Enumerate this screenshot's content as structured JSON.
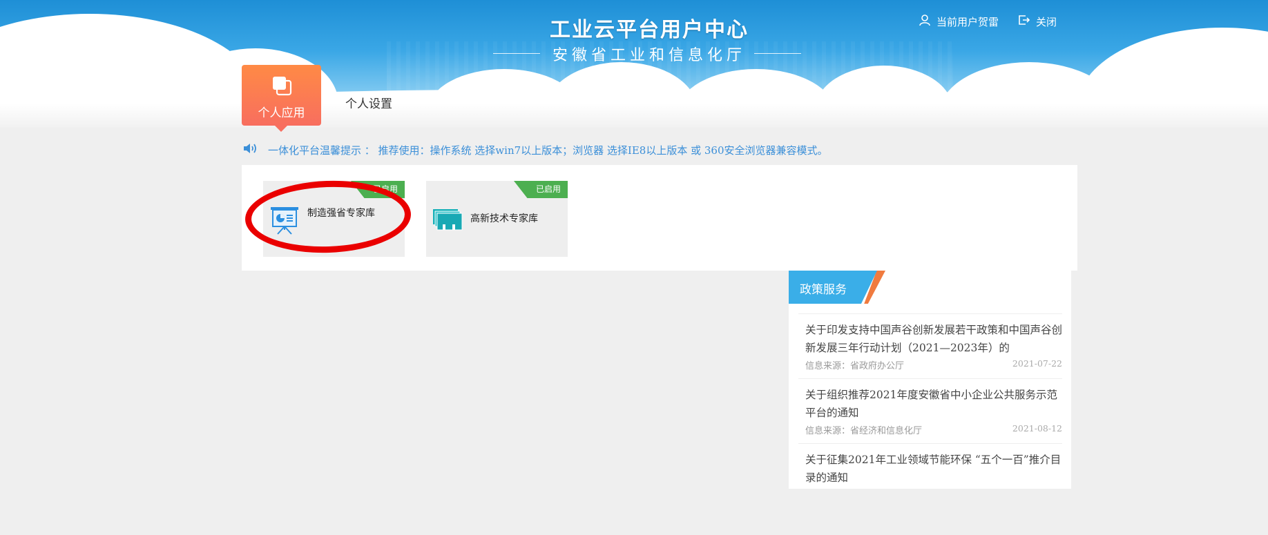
{
  "header": {
    "title": "工业云平台用户中心",
    "subtitle": "安徽省工业和信息化厅",
    "user_label": "当前用户贺雷",
    "close_label": "关闭"
  },
  "tabs": [
    {
      "label": "个人应用",
      "active": true
    },
    {
      "label": "个人设置",
      "active": false
    }
  ],
  "notice": {
    "text": "一体化平台温馨提示 ： 推荐使用：操作系统 选择win7以上版本；浏览器 选择IE8以上版本 或 360安全浏览器兼容模式。"
  },
  "apps": [
    {
      "name": "制造强省专家库",
      "status": "已启用",
      "icon": "presentation-board-icon",
      "highlighted": true
    },
    {
      "name": "高新技术专家库",
      "status": "已启用",
      "icon": "stacked-cards-icon",
      "highlighted": false
    }
  ],
  "policy": {
    "header": "政策服务",
    "items": [
      {
        "title": "关于印发支持中国声谷创新发展若干政策和中国声谷创新发展三年行动计划（2021—2023年）的",
        "source": "信息来源：省政府办公厅",
        "date": "2021-07-22"
      },
      {
        "title": "关于组织推荐2021年度安徽省中小企业公共服务示范平台的通知",
        "source": "信息来源：省经济和信息化厅",
        "date": "2021-08-12"
      },
      {
        "title": "关于征集2021年工业领域节能环保 “五个一百”推介目录的通知",
        "source": "",
        "date": ""
      }
    ]
  },
  "colors": {
    "banner_blue": "#1e8fd6",
    "tab_orange": "#ff8a45",
    "notice_blue": "#3b8fd8",
    "status_green": "#4caf50",
    "policy_blue": "#3aaee8",
    "highlight_red": "#ea0000"
  }
}
